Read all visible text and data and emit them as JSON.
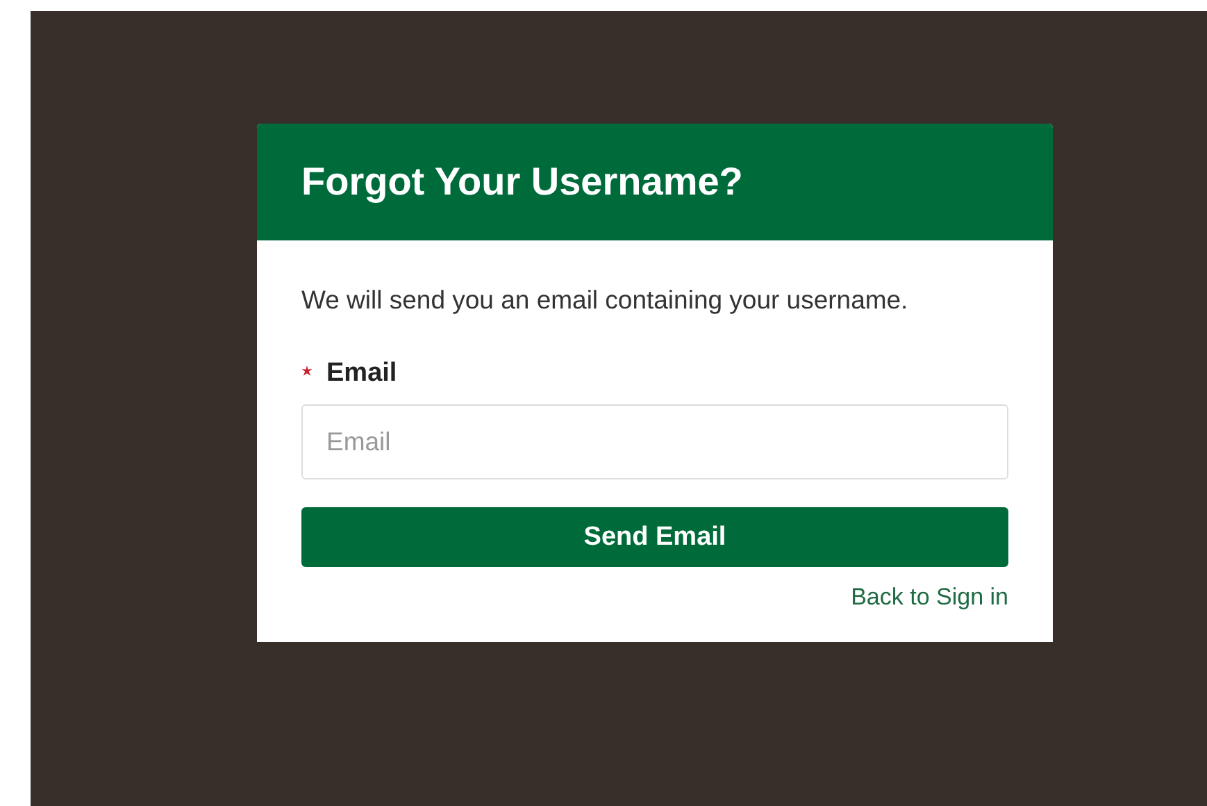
{
  "dialog": {
    "title": "Forgot Your Username?",
    "description": "We will send you an email containing your username.",
    "field": {
      "label": "Email",
      "required": true,
      "placeholder": "Email"
    },
    "submit_button": "Send Email",
    "back_link": "Back to Sign in"
  }
}
